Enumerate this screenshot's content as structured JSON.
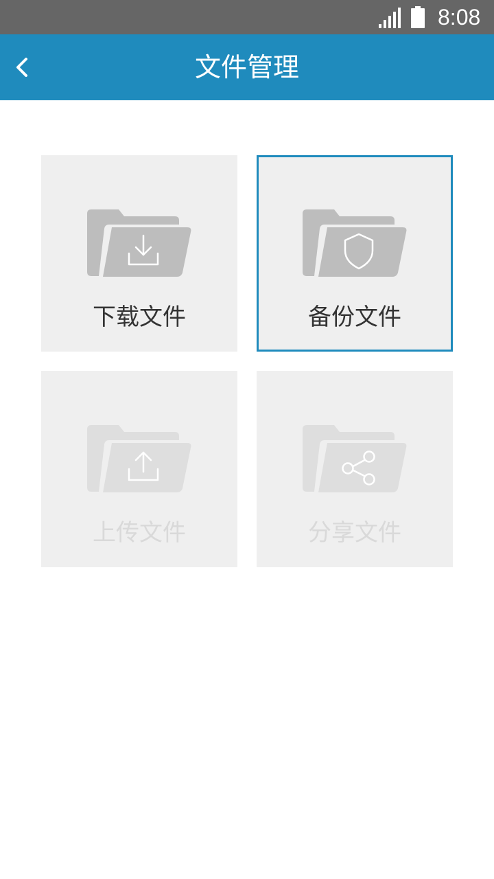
{
  "status_bar": {
    "time": "8:08",
    "signal_icon": "cellular-signal-icon",
    "battery_icon": "battery-full-icon"
  },
  "app_bar": {
    "title": "文件管理",
    "back_icon": "chevron-left-icon",
    "background_color": "#1f8bbd"
  },
  "tiles": [
    {
      "label": "下载文件",
      "icon": "folder-download-icon",
      "state": "enabled"
    },
    {
      "label": "备份文件",
      "icon": "folder-shield-icon",
      "state": "selected"
    },
    {
      "label": "上传文件",
      "icon": "folder-upload-icon",
      "state": "disabled"
    },
    {
      "label": "分享文件",
      "icon": "folder-share-icon",
      "state": "disabled"
    }
  ],
  "colors": {
    "accent": "#1f8bbd",
    "tile_background": "#efefef",
    "folder_enabled": "#bdbdbd",
    "folder_disabled": "#dedede",
    "text_enabled": "#333333",
    "text_disabled": "#d9d9d9"
  }
}
